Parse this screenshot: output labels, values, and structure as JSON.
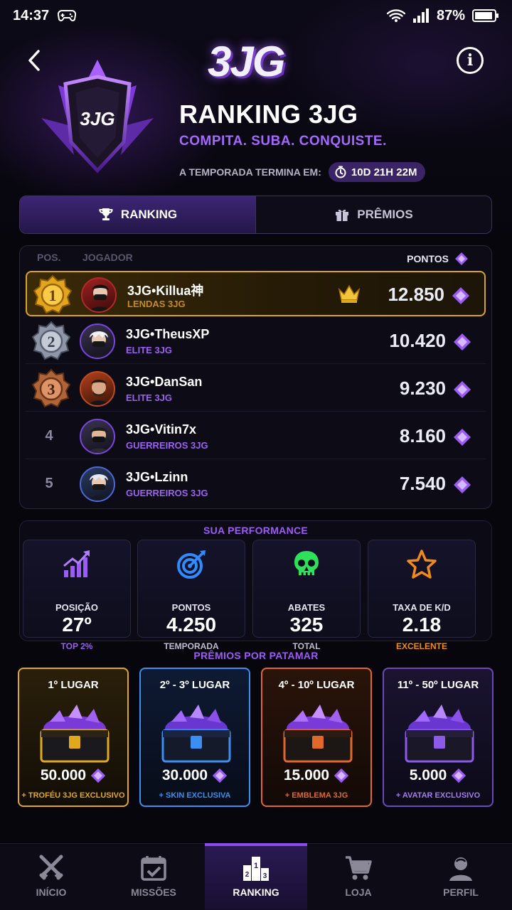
{
  "status_bar": {
    "time": "14:37",
    "battery": "87%"
  },
  "header": {
    "logo_text": "3JG",
    "emblem_text": "3JG",
    "title": "RANKING 3JG",
    "subtitle": "COMPITA. SUBA. CONQUISTE.",
    "season_label": "A TEMPORADA TERMINA EM:",
    "season_timer": "10D 21H 22M"
  },
  "tabs": [
    {
      "label": "RANKING",
      "icon": "trophy-icon",
      "active": true
    },
    {
      "label": "PRÊMIOS",
      "icon": "gift-icon",
      "active": false
    }
  ],
  "ranking": {
    "headers": {
      "pos": "POS.",
      "player": "JOGADOR",
      "points": "PONTOS"
    },
    "rows": [
      {
        "pos": "1",
        "name": "3JG•Killua神",
        "team": "LENDAS 3JG",
        "points": "12.850",
        "badge": "gold",
        "crown": true
      },
      {
        "pos": "2",
        "name": "3JG•TheusXP",
        "team": "ELITE 3JG",
        "points": "10.420",
        "badge": "silver"
      },
      {
        "pos": "3",
        "name": "3JG•DanSan",
        "team": "ELITE 3JG",
        "points": "9.230",
        "badge": "bronze"
      },
      {
        "pos": "4",
        "name": "3JG•Vitin7x",
        "team": "GUERREIROS 3JG",
        "points": "8.160"
      },
      {
        "pos": "5",
        "name": "3JG•Lzinn",
        "team": "GUERREIROS 3JG",
        "points": "7.540"
      }
    ]
  },
  "performance": {
    "title": "SUA PERFORMANCE",
    "stats": [
      {
        "label": "POSIÇÃO",
        "value": "27º",
        "sub": "TOP 2%",
        "icon": "chart-up-icon",
        "color": "#9a5cf5",
        "sub_color": "#9a5cf5"
      },
      {
        "label": "PONTOS",
        "value": "4.250",
        "sub": "TEMPORADA",
        "icon": "target-icon",
        "color": "#2f8cff",
        "sub_color": "#c0bccf"
      },
      {
        "label": "ABATES",
        "value": "325",
        "sub": "TOTAL",
        "icon": "skull-icon",
        "color": "#2fe05a",
        "sub_color": "#c0bccf"
      },
      {
        "label": "TAXA DE K/D",
        "value": "2.18",
        "sub": "EXCELENTE",
        "icon": "star-icon",
        "color": "#f08a1c",
        "sub_color": "#f08a1c"
      }
    ]
  },
  "prizes": {
    "title": "PRÊMIOS POR PATAMAR",
    "tiers": [
      {
        "label": "1º LUGAR",
        "amount": "50.000",
        "bonus": "+ TROFÉU 3JG EXCLUSIVO",
        "color": "#e0a81c"
      },
      {
        "label": "2º - 3º LUGAR",
        "amount": "30.000",
        "bonus": "+ SKIN EXCLUSIVA",
        "color": "#3a8ff0"
      },
      {
        "label": "4º - 10º LUGAR",
        "amount": "15.000",
        "bonus": "+ EMBLEMA 3JG",
        "color": "#e0682a"
      },
      {
        "label": "11º - 50º LUGAR",
        "amount": "5.000",
        "bonus": "+ AVATAR EXCLUSIVO",
        "color": "#8c5ae8"
      }
    ]
  },
  "nav": [
    {
      "label": "INÍCIO",
      "icon": "swords-icon"
    },
    {
      "label": "MISSÕES",
      "icon": "calendar-check-icon"
    },
    {
      "label": "RANKING",
      "icon": "podium-icon",
      "active": true
    },
    {
      "label": "LOJA",
      "icon": "cart-icon"
    },
    {
      "label": "PERFIL",
      "icon": "user-icon"
    }
  ]
}
